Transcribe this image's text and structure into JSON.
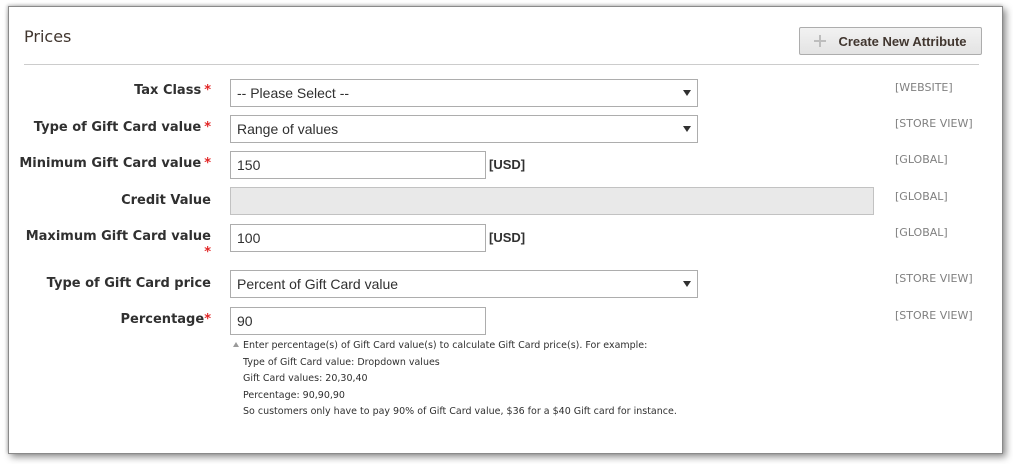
{
  "section": {
    "title": "Prices"
  },
  "toolbar": {
    "create_attribute_label": "Create New Attribute"
  },
  "fields": {
    "tax_class": {
      "label": "Tax Class",
      "value": "-- Please Select --",
      "scope": "[WEBSITE]",
      "required": "*"
    },
    "gift_card_type": {
      "label": "Type of Gift Card value",
      "value": "Range of values",
      "scope": "[STORE VIEW]",
      "required": "*"
    },
    "min_value": {
      "label": "Minimum Gift Card value",
      "value": "150",
      "unit": "[USD]",
      "scope": "[GLOBAL]",
      "required": "*"
    },
    "credit_value": {
      "label": "Credit Value",
      "value": "",
      "scope": "[GLOBAL]"
    },
    "max_value": {
      "label": "Maximum Gift Card value",
      "value": "100",
      "unit": "[USD]",
      "scope": "[GLOBAL]",
      "required": "*"
    },
    "price_type": {
      "label": "Type of Gift Card price",
      "value": "Percent of Gift Card value",
      "scope": "[STORE VIEW]"
    },
    "percentage": {
      "label": "Percentage",
      "value": "90",
      "scope": "[STORE VIEW]",
      "required": "*"
    }
  },
  "note": {
    "lines": [
      "Enter percentage(s) of Gift Card value(s) to calculate Gift Card price(s). For example:",
      "Type of Gift Card value: Dropdown values",
      "Gift Card values: 20,30,40",
      "Percentage: 90,90,90",
      "So customers only have to pay 90% of Gift Card value, $36 for a $40 Gift card for instance."
    ]
  },
  "icons": {
    "create": "plus-icon",
    "select_arrow": "caret-down-icon",
    "note": "triangle-up-icon"
  },
  "colors": {
    "required": "#e22626",
    "scope": "#808080",
    "disabled_field": "#e9e9e9"
  }
}
